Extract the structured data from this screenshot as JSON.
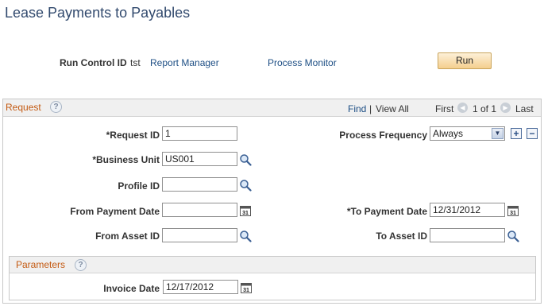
{
  "page": {
    "title": "Lease Payments to Payables"
  },
  "run_control": {
    "label": "Run Control ID",
    "value": "tst",
    "report_manager": "Report Manager",
    "process_monitor": "Process Monitor",
    "run_button": "Run"
  },
  "request": {
    "title": "Request",
    "help": "?",
    "nav": {
      "find": "Find",
      "separator": "|",
      "view_all": "View All",
      "first": "First",
      "count": "1 of 1",
      "last": "Last"
    },
    "fields": {
      "request_id": {
        "label": "*Request ID",
        "value": "1"
      },
      "business_unit": {
        "label": "*Business Unit",
        "value": "US001"
      },
      "profile_id": {
        "label": "Profile ID",
        "value": ""
      },
      "from_payment_date": {
        "label": "From Payment Date",
        "value": ""
      },
      "from_asset_id": {
        "label": "From Asset ID",
        "value": ""
      },
      "process_frequency": {
        "label": "Process Frequency",
        "value": "Always"
      },
      "to_payment_date": {
        "label": "*To Payment Date",
        "value": "12/31/2012"
      },
      "to_asset_id": {
        "label": "To Asset ID",
        "value": ""
      }
    },
    "row_buttons": {
      "add": "+",
      "delete": "−"
    }
  },
  "parameters": {
    "title": "Parameters",
    "help": "?",
    "invoice_date": {
      "label": "Invoice Date",
      "value": "12/17/2012"
    }
  },
  "icons": {
    "lookup": "magnifier-lookup-icon",
    "calendar": "calendar-icon",
    "calendar_glyph": "31"
  },
  "colors": {
    "title": "#324a6e",
    "group_title": "#c45a12",
    "link": "#1e4f85",
    "run_button": "#f4cf8e"
  }
}
